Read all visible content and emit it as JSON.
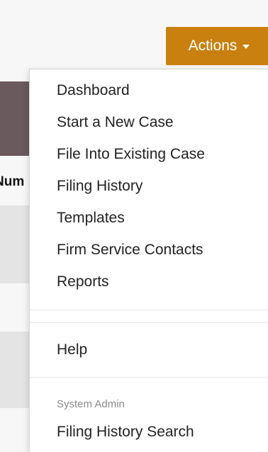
{
  "background": {
    "table_header_fragment": "Num",
    "band_color": "#6a5a5d"
  },
  "actions_button": {
    "label": "Actions",
    "color": "#c9800e",
    "icon": "caret-down-icon"
  },
  "menu": {
    "items": [
      {
        "label": "Dashboard"
      },
      {
        "label": "Start a New Case"
      },
      {
        "label": "File Into Existing Case"
      },
      {
        "label": "Filing History"
      },
      {
        "label": "Templates"
      },
      {
        "label": "Firm Service Contacts"
      },
      {
        "label": "Reports"
      }
    ],
    "help_label": "Help",
    "admin_header": "System Admin",
    "admin_items": [
      {
        "label": "Filing History Search"
      }
    ]
  }
}
